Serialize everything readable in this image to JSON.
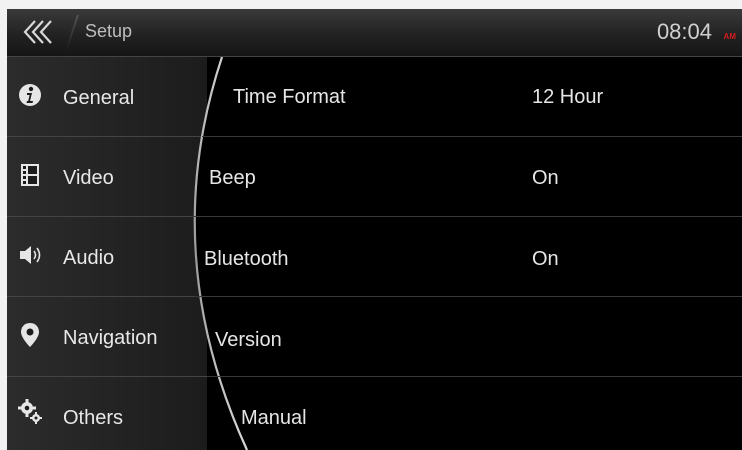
{
  "header": {
    "back_icon": "triple-chevron-left-icon",
    "title": "Setup",
    "time": "08:04",
    "ampm": "AM"
  },
  "sidebar": {
    "items": [
      {
        "label": "General",
        "icon": "info-icon"
      },
      {
        "label": "Video",
        "icon": "film-icon"
      },
      {
        "label": "Audio",
        "icon": "speaker-icon"
      },
      {
        "label": "Navigation",
        "icon": "map-pin-icon"
      },
      {
        "label": "Others",
        "icon": "gears-icon"
      }
    ]
  },
  "settings": {
    "rows": [
      {
        "label": "Time Format",
        "value": "12 Hour"
      },
      {
        "label": "Beep",
        "value": "On"
      },
      {
        "label": "Bluetooth",
        "value": "On"
      },
      {
        "label": "Version",
        "value": ""
      },
      {
        "label": "Manual",
        "value": ""
      }
    ]
  },
  "colors": {
    "accent_red": "#d21d1d",
    "background": "#000000",
    "text": "#e6e6e6"
  }
}
